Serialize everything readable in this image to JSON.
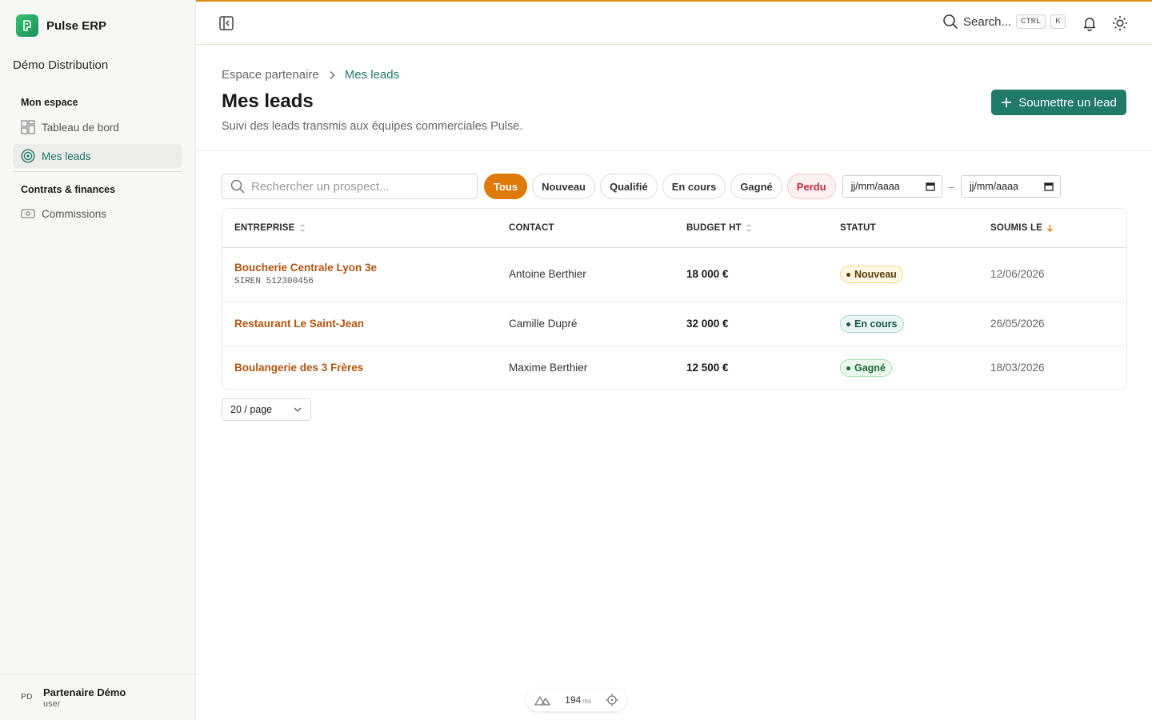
{
  "app": {
    "name": "Pulse ERP",
    "org": "Démo Distribution"
  },
  "sidebar": {
    "sections": [
      {
        "heading": "Mon espace",
        "items": [
          {
            "label": "Tableau de bord",
            "icon": "dashboard-icon",
            "active": false
          },
          {
            "label": "Mes leads",
            "icon": "target-icon",
            "active": true
          }
        ]
      },
      {
        "heading": "Contrats & finances",
        "items": [
          {
            "label": "Commissions",
            "icon": "banknote-icon",
            "active": false
          }
        ]
      }
    ],
    "user": {
      "initials": "PD",
      "name": "Partenaire Démo",
      "role": "user"
    }
  },
  "topbar": {
    "search_label": "Search...",
    "shortcut": [
      "CTRL",
      "K"
    ]
  },
  "page": {
    "breadcrumb": [
      "Espace partenaire",
      "Mes leads"
    ],
    "title": "Mes leads",
    "subtitle": "Suivi des leads transmis aux équipes commerciales Pulse.",
    "primary_action": "Soumettre un lead"
  },
  "filters": {
    "search_placeholder": "Rechercher un prospect...",
    "status_chips": [
      "Tous",
      "Nouveau",
      "Qualifié",
      "En cours",
      "Gagné",
      "Perdu"
    ],
    "active_chip": "Tous",
    "date_from_placeholder": "jj/mm/aaaa",
    "date_separator": "–",
    "date_to_placeholder": "jj/mm/aaaa"
  },
  "table": {
    "columns": [
      "ENTREPRISE",
      "CONTACT",
      "BUDGET HT",
      "STATUT",
      "SOUMIS LE"
    ],
    "rows": [
      {
        "company": "Boucherie Centrale Lyon 3e",
        "siren": "SIREN 512300456",
        "contact": "Antoine Berthier",
        "budget": "18 000 €",
        "status": "Nouveau",
        "status_kind": "nouveau",
        "date": "12/06/2026"
      },
      {
        "company": "Restaurant Le Saint-Jean",
        "siren": "",
        "contact": "Camille Dupré",
        "budget": "32 000 €",
        "status": "En cours",
        "status_kind": "encours",
        "date": "26/05/2026"
      },
      {
        "company": "Boulangerie des 3 Frères",
        "siren": "",
        "contact": "Maxime Berthier",
        "budget": "12 500 €",
        "status": "Gagné",
        "status_kind": "gagne",
        "date": "18/03/2026"
      }
    ]
  },
  "pagination": {
    "page_size": "20 / page"
  },
  "devtools": {
    "ms": "194",
    "unit": "ms"
  },
  "colors": {
    "accent": "#1f7a68",
    "orange": "#dd7a09",
    "company_link": "#b4540f",
    "lost": "#c4283c"
  }
}
